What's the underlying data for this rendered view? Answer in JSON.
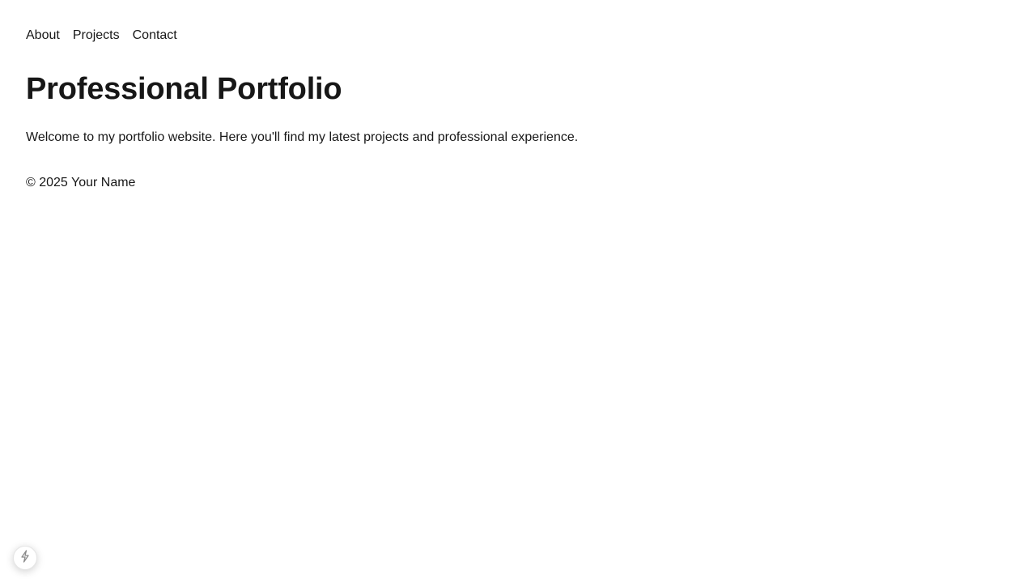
{
  "nav": {
    "items": [
      {
        "label": "About"
      },
      {
        "label": "Projects"
      },
      {
        "label": "Contact"
      }
    ]
  },
  "main": {
    "title": "Professional Portfolio",
    "intro": "Welcome to my portfolio website. Here you'll find my latest projects and professional experience."
  },
  "footer": {
    "text": "© 2025 Your Name"
  },
  "dev_badge": {
    "icon": "lightning-bolt-icon"
  },
  "colors": {
    "text": "#171717",
    "background": "#ffffff"
  }
}
